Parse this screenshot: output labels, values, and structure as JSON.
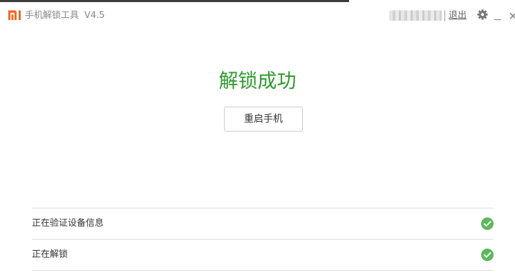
{
  "app": {
    "title": "手机解锁工具",
    "version": "V4.5",
    "logo_icon": "mi-logo-icon",
    "accent_color": "#f06a22"
  },
  "header": {
    "account_name": "13xxxxxxx2",
    "logout_label": "退出",
    "settings_icon": "gear-icon",
    "minimize_icon": "minimize-icon",
    "close_icon": "close-icon"
  },
  "main": {
    "status_title": "解锁成功",
    "status_color": "#2e9a2e",
    "restart_button_label": "重启手机"
  },
  "steps": [
    {
      "label": "正在验证设备信息",
      "status": "done",
      "status_icon": "check-circle-icon"
    },
    {
      "label": "正在解锁",
      "status": "done",
      "status_icon": "check-circle-icon"
    }
  ],
  "colors": {
    "check_green": "#5cb85c"
  }
}
